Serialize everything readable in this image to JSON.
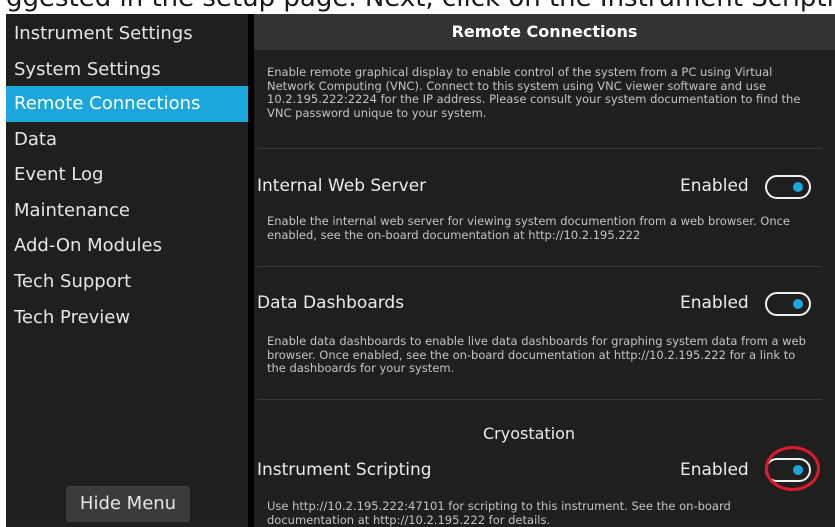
{
  "top_strip_text": "ggested in the setup page. Next, click on the Instrument Scripting",
  "sidebar": {
    "items": [
      {
        "label": "Instrument Settings"
      },
      {
        "label": "System Settings"
      },
      {
        "label": "Remote Connections",
        "active": true
      },
      {
        "label": "Data"
      },
      {
        "label": "Event Log"
      },
      {
        "label": "Maintenance"
      },
      {
        "label": "Add-On Modules"
      },
      {
        "label": "Tech Support"
      },
      {
        "label": "Tech Preview"
      }
    ],
    "hide_menu_label": "Hide Menu"
  },
  "main": {
    "title": "Remote Connections",
    "intro_text": "Enable remote graphical display to enable control of the system from a PC using Virtual Network Computing (VNC). Connect to this system using VNC viewer software and use 10.2.195.222:2224 for the IP address. Please consult your system documentation to find the VNC password unique to your system.",
    "sections": [
      {
        "title": "Internal Web Server",
        "status": "Enabled",
        "enabled": true,
        "description": "Enable the internal web server for viewing system documention from a web browser. Once enabled, see the on-board documentation at http://10.2.195.222"
      },
      {
        "title": "Data Dashboards",
        "status": "Enabled",
        "enabled": true,
        "description": "Enable data dashboards to enable live data dashboards for graphing system data from a web browser. Once enabled, see the on-board documentation at http://10.2.195.222 for a link to the dashboards for your system."
      }
    ],
    "group_label": "Cryostation",
    "scripting": {
      "title": "Instrument Scripting",
      "status": "Enabled",
      "enabled": true,
      "description": "Use http://10.2.195.222:47101 for scripting to this instrument. See the on-board documentation at http://10.2.195.222 for details."
    }
  },
  "colors": {
    "accent": "#1ba6dc",
    "highlight": "#e0192a",
    "background": "#1f1f1f",
    "header": "#333333"
  }
}
